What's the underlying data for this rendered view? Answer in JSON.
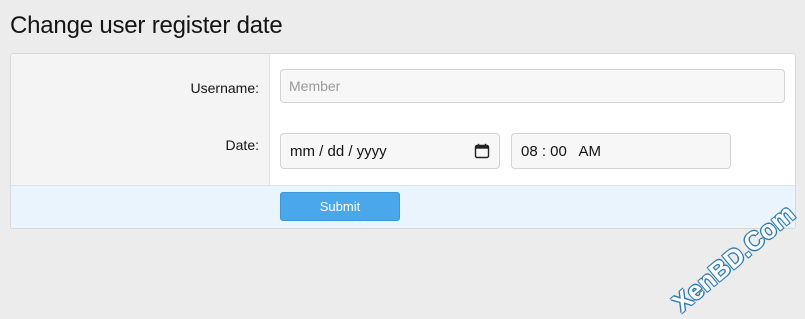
{
  "page": {
    "title": "Change user register date"
  },
  "form": {
    "username_label": "Username:",
    "username_placeholder": "Member",
    "username_value": "",
    "date_label": "Date:",
    "date_value": "mm / dd / yyyy",
    "time_value": "08 : 00   AM",
    "submit_label": "Submit"
  },
  "icons": {
    "date_picker": "calendar-icon"
  },
  "watermark": {
    "text": "XenBD.Com"
  },
  "colors": {
    "accent": "#4aa7ea",
    "footer_bg": "#eaf4fd",
    "page_bg": "#ececec"
  }
}
